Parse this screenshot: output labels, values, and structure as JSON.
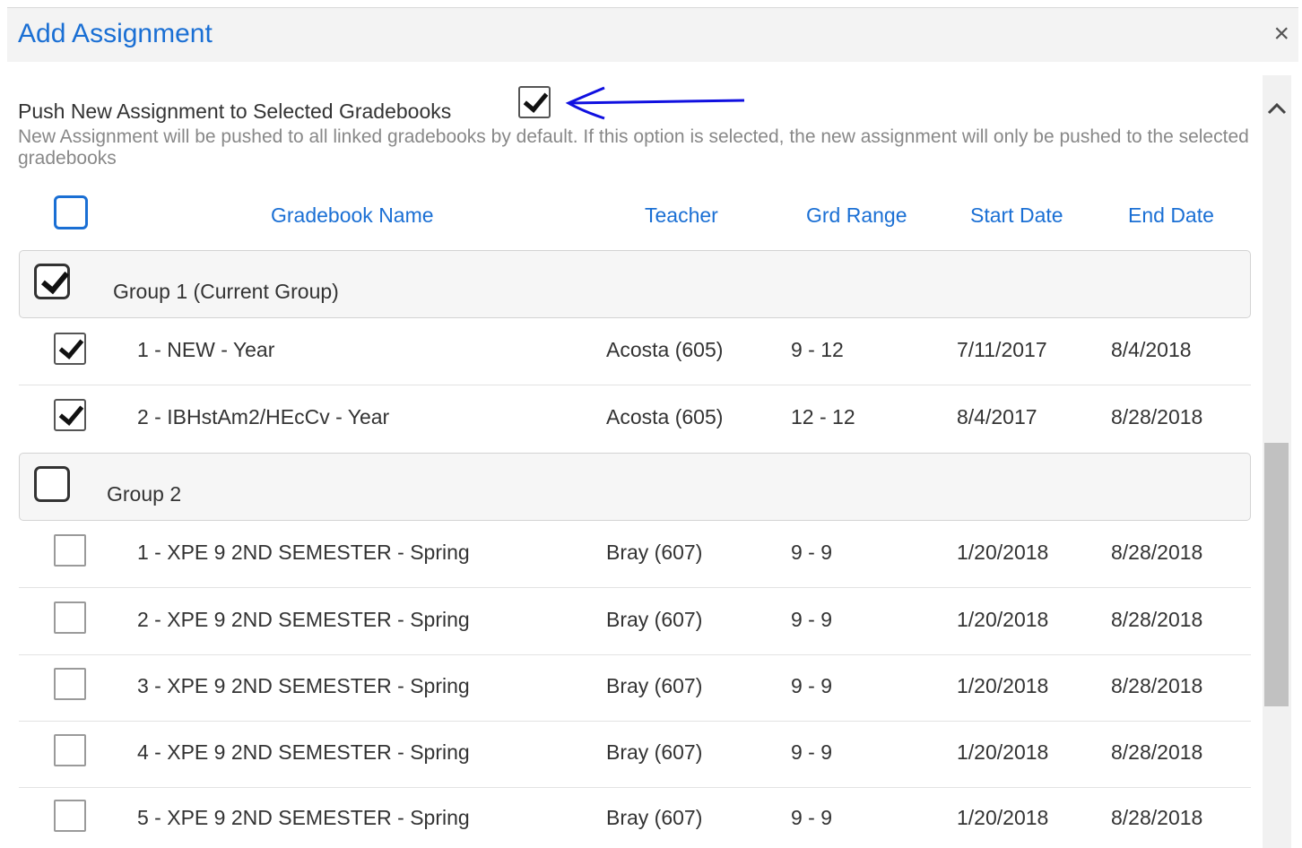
{
  "dialog": {
    "title": "Add Assignment",
    "close_label": "×"
  },
  "push_option": {
    "label": "Push New Assignment to Selected Gradebooks",
    "checked": true,
    "hint": "New Assignment will be pushed to all linked gradebooks by default. If this option is selected, the new assignment will only be pushed to the selected gradebooks"
  },
  "table": {
    "headers": {
      "name": "Gradebook Name",
      "teacher": "Teacher",
      "grd_range": "Grd Range",
      "start": "Start Date",
      "end": "End Date"
    },
    "groups": [
      {
        "label": "Group 1 (Current Group)",
        "checked": true,
        "rows": [
          {
            "name": "1 - NEW - Year",
            "teacher": "Acosta (605)",
            "grd_range": "9 - 12",
            "start": "7/11/2017",
            "end": "8/4/2018",
            "checked": true
          },
          {
            "name": "2 - IBHstAm2/HEcCv - Year",
            "teacher": "Acosta (605)",
            "grd_range": "12 - 12",
            "start": "8/4/2017",
            "end": "8/28/2018",
            "checked": true
          }
        ]
      },
      {
        "label": "Group 2",
        "checked": false,
        "rows": [
          {
            "name": "1 - XPE 9 2ND SEMESTER - Spring",
            "teacher": "Bray (607)",
            "grd_range": "9 - 9",
            "start": "1/20/2018",
            "end": "8/28/2018",
            "checked": false
          },
          {
            "name": "2 - XPE 9 2ND SEMESTER - Spring",
            "teacher": "Bray (607)",
            "grd_range": "9 - 9",
            "start": "1/20/2018",
            "end": "8/28/2018",
            "checked": false
          },
          {
            "name": "3 - XPE 9 2ND SEMESTER - Spring",
            "teacher": "Bray (607)",
            "grd_range": "9 - 9",
            "start": "1/20/2018",
            "end": "8/28/2018",
            "checked": false
          },
          {
            "name": "4 - XPE 9 2ND SEMESTER - Spring",
            "teacher": "Bray (607)",
            "grd_range": "9 - 9",
            "start": "1/20/2018",
            "end": "8/28/2018",
            "checked": false
          },
          {
            "name": "5 - XPE 9 2ND SEMESTER - Spring",
            "teacher": "Bray (607)",
            "grd_range": "9 - 9",
            "start": "1/20/2018",
            "end": "8/28/2018",
            "checked": false
          }
        ]
      }
    ]
  },
  "colors": {
    "accent": "#1a6fd4",
    "annotation_arrow": "#1010e0"
  },
  "icons": {
    "close": "close-icon",
    "scroll_up": "chevron-up-icon",
    "annotation": "arrow-left-icon"
  }
}
